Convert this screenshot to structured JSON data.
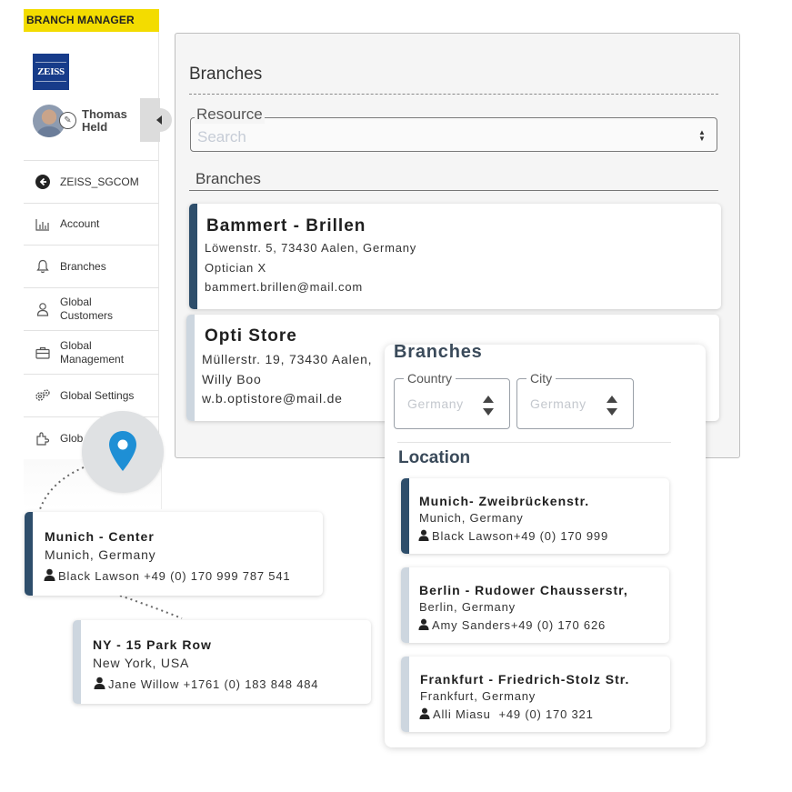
{
  "app": {
    "brand_label": "BRANCH MANAGER",
    "logo_text": "ZEISS"
  },
  "user": {
    "name": "Thomas Held"
  },
  "sidebar": {
    "items": [
      {
        "label": "ZEISS_SGCOM",
        "icon": "back-arrow-icon"
      },
      {
        "label": "Account",
        "icon": "bar-chart-icon"
      },
      {
        "label": "Branches",
        "icon": "bell-icon"
      },
      {
        "label": "Global Customers",
        "icon": "person-icon"
      },
      {
        "label": "Global Management",
        "icon": "briefcase-icon"
      },
      {
        "label": "Global Settings",
        "icon": "gears-icon"
      },
      {
        "label": "Glob",
        "icon": "puzzle-icon"
      }
    ]
  },
  "main": {
    "title": "Branches",
    "resource": {
      "legend": "Resource",
      "placeholder": "Search"
    },
    "branches_label": "Branches",
    "cards": [
      {
        "name": "Bammert - Brillen",
        "address": "Löwenstr. 5, 73430 Aalen, Germany",
        "role": "Optician X",
        "email": "bammert.brillen@mail.com",
        "accent": "#2e4e6b"
      },
      {
        "name": "Opti Store",
        "address": "Müllerstr. 19, 73430 Aalen,",
        "role": "Willy Boo",
        "email": "w.b.optistore@mail.de",
        "accent": "#cdd6df"
      }
    ]
  },
  "popup": {
    "title": "Branches",
    "country": {
      "legend": "Country",
      "value": "Germany"
    },
    "city": {
      "legend": "City",
      "value": "Germany"
    },
    "location_title": "Location",
    "locations": [
      {
        "name": "Munich- Zweibrückenstr.",
        "place": "Munich, Germany",
        "contact": "Black Lawson",
        "phone": "+49 (0) 170 999",
        "accent": "#2e4e6b"
      },
      {
        "name": "Berlin - Rudower Chausserstr,",
        "place": "Berlin, Germany",
        "contact": "Amy Sanders",
        "phone": "+49 (0) 170 626",
        "accent": "#cdd6df"
      },
      {
        "name": "Frankfurt - Friedrich-Stolz Str.",
        "place": "Frankfurt, Germany",
        "contact": "Alli Miasu",
        "phone": "+49 (0) 170 321",
        "accent": "#cdd6df"
      }
    ]
  },
  "floating_cards": [
    {
      "name": "Munich - Center",
      "place": "Munich, Germany",
      "contact": "Black Lawson",
      "phone": "+49 (0) 170 999 787 541",
      "accent": "#2e4e6b"
    },
    {
      "name": "NY - 15 Park Row",
      "place": "New York, USA",
      "contact": "Jane Willow",
      "phone": "+1761 (0) 183 848 484",
      "accent": "#cdd6df"
    }
  ],
  "colors": {
    "brand_yellow": "#f3dc00",
    "zeiss_blue": "#173c8a",
    "pin_blue": "#1e8fd5",
    "accent_dark": "#2e4e6b",
    "accent_light": "#cdd6df"
  }
}
